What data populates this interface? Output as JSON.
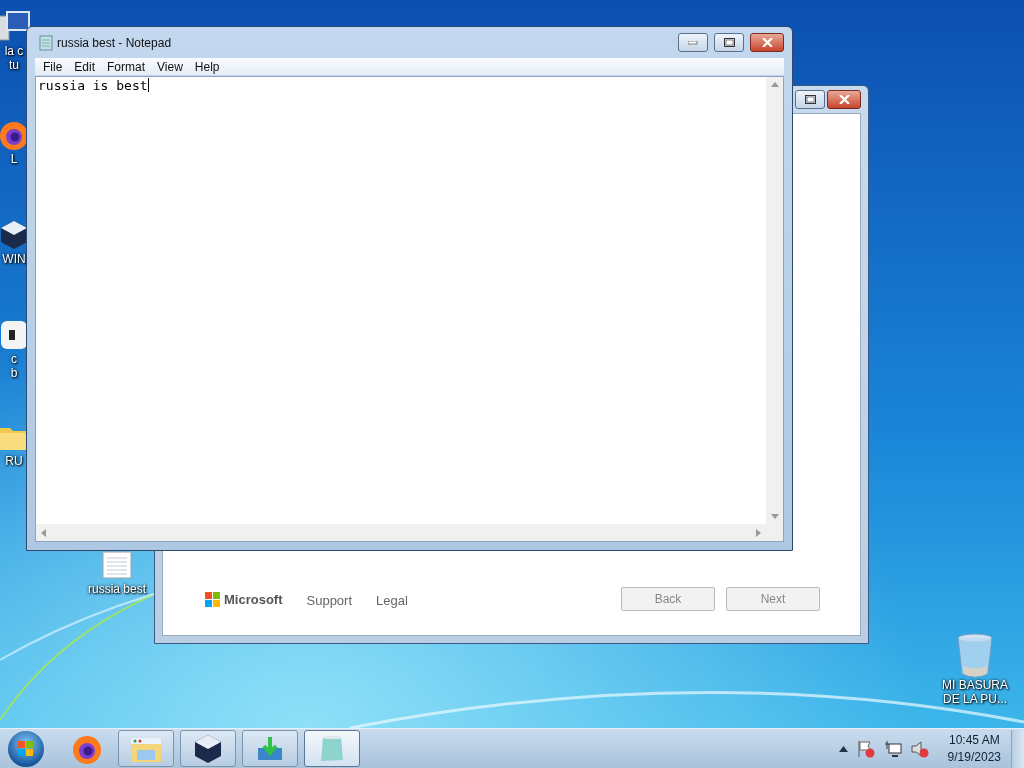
{
  "desktop_icons": [
    {
      "kind": "computer",
      "lines": [
        "la c",
        "tu"
      ]
    },
    {
      "kind": "firefox",
      "lines": [
        "L"
      ]
    },
    {
      "kind": "virtualbox",
      "lines": [
        "WIN"
      ]
    },
    {
      "kind": "app",
      "lines": [
        "c",
        "b"
      ]
    },
    {
      "kind": "folder",
      "lines": [
        "RU"
      ]
    },
    {
      "kind": "text-file",
      "lines": [
        "russia best"
      ]
    },
    {
      "kind": "recycle-bin",
      "lines": [
        "MI BASURA",
        "DE LA PU..."
      ]
    }
  ],
  "setup_window": {
    "footer_links": [
      "Support",
      "Legal"
    ],
    "brand": "Microsoft",
    "buttons": [
      {
        "label": "Back",
        "disabled": true
      },
      {
        "label": "Next",
        "disabled": true
      }
    ]
  },
  "notepad": {
    "title": "russia best - Notepad",
    "menu": [
      "File",
      "Edit",
      "Format",
      "View",
      "Help"
    ],
    "content": "russia is best"
  },
  "taskbar": {
    "items": [
      {
        "kind": "firefox",
        "running": false,
        "active": false
      },
      {
        "kind": "explorer",
        "running": true,
        "active": false
      },
      {
        "kind": "virtualbox",
        "running": true,
        "active": false
      },
      {
        "kind": "installer",
        "running": true,
        "active": false
      },
      {
        "kind": "notepad",
        "running": true,
        "active": true
      }
    ],
    "clock": {
      "time": "10:45 AM",
      "date": "9/19/2023"
    }
  }
}
